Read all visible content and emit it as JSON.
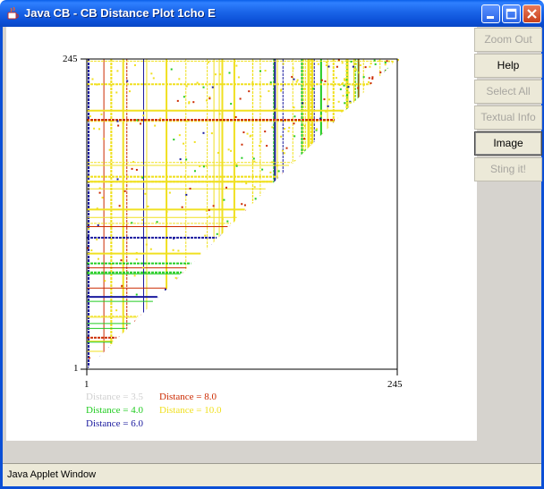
{
  "window": {
    "title": "Java CB - CB Distance Plot 1cho E",
    "icon": "java-cup-icon",
    "controls": [
      "minimize-icon",
      "maximize-icon",
      "close-icon"
    ]
  },
  "plot": {
    "y_top_label": "245",
    "y_bottom_label": "1",
    "x_left_label": "1",
    "x_right_label": "245"
  },
  "legend": [
    {
      "label": "Distance = 3.5",
      "color": "#d0d0d0"
    },
    {
      "label": "Distance = 8.0",
      "color": "#cc2a00"
    },
    {
      "label": "Distance = 4.0",
      "color": "#22cc22"
    },
    {
      "label": "Distance = 10.0",
      "color": "#f0e020"
    },
    {
      "label": "Distance = 6.0",
      "color": "#1a1a9e"
    }
  ],
  "buttons": [
    {
      "label": "Zoom Out",
      "enabled": false
    },
    {
      "label": "Help",
      "enabled": true
    },
    {
      "label": "Select All",
      "enabled": false
    },
    {
      "label": "Textual Info",
      "enabled": false
    },
    {
      "label": "Image",
      "enabled": true,
      "focused": true
    },
    {
      "label": "Sting it!",
      "enabled": false
    }
  ],
  "status": {
    "text": "Java Applet Window"
  }
}
